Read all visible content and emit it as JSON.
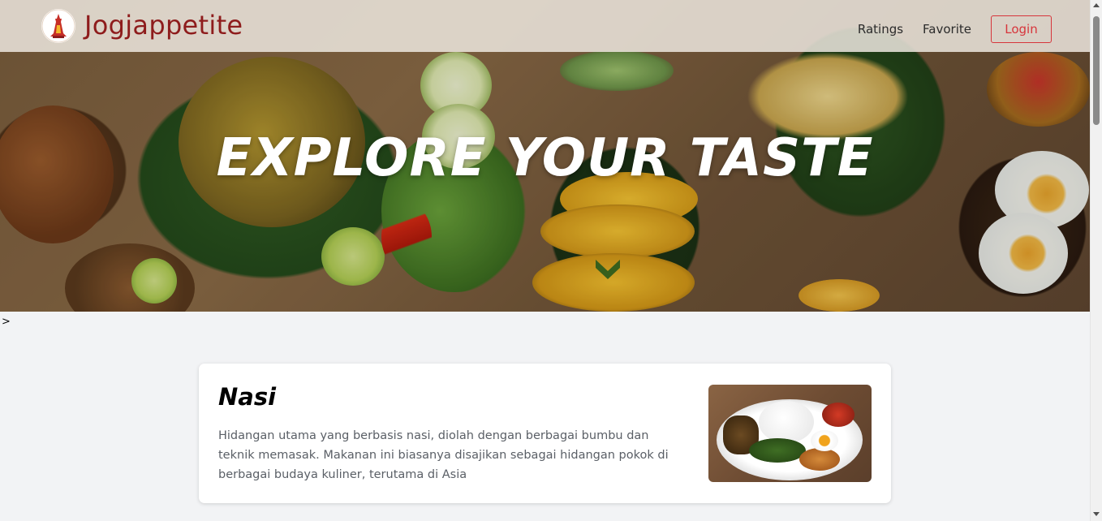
{
  "header": {
    "brand": "Jogjappetite",
    "nav": {
      "ratings": "Ratings",
      "favorite": "Favorite",
      "login": "Login"
    }
  },
  "hero": {
    "title": "EXPLORE YOUR TASTE",
    "scroll_icon": "chevron-down-icon"
  },
  "stray_text": ">",
  "card": {
    "title": "Nasi",
    "description": "Hidangan utama yang berbasis nasi, diolah dengan berbagai bumbu dan teknik memasak. Makanan ini biasanya disajikan sebagai hidangan pokok di berbagai budaya kuliner, terutama di Asia"
  },
  "colors": {
    "brand": "#8e1c1c",
    "login_accent": "#d7353b",
    "page_background": "#f2f3f5",
    "chevron": "#2e5c1c"
  }
}
